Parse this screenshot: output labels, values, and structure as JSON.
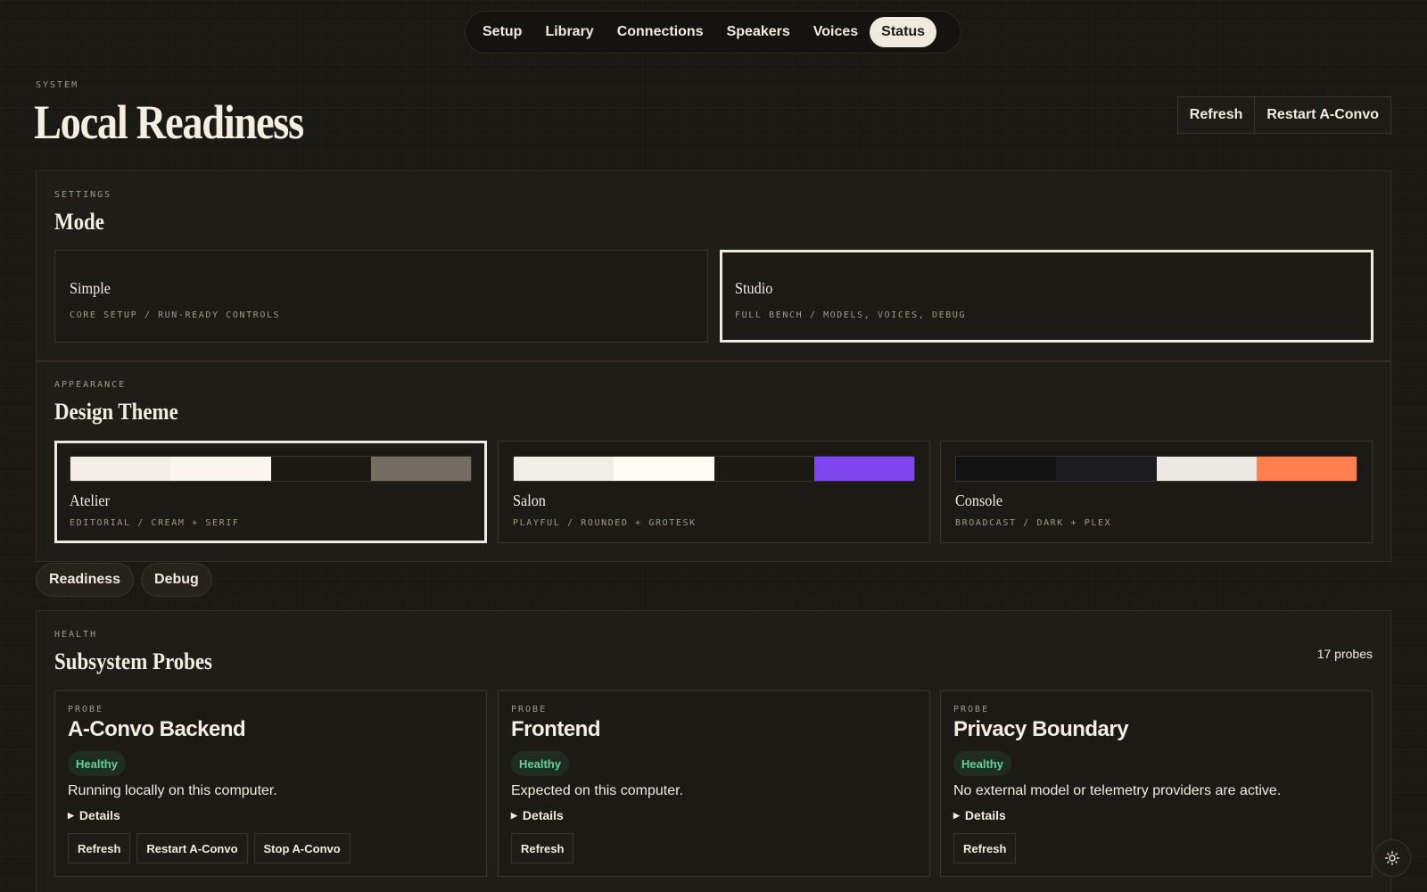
{
  "nav": {
    "items": [
      {
        "label": "Setup",
        "active": false
      },
      {
        "label": "Library",
        "active": false
      },
      {
        "label": "Connections",
        "active": false
      },
      {
        "label": "Speakers",
        "active": false
      },
      {
        "label": "Voices",
        "active": false
      },
      {
        "label": "Status",
        "active": true
      }
    ]
  },
  "header": {
    "eyebrow": "SYSTEM",
    "title": "Local Readiness",
    "refresh_label": "Refresh",
    "restart_label": "Restart A-Convo"
  },
  "mode": {
    "eyebrow": "SETTINGS",
    "title": "Mode",
    "options": [
      {
        "title": "Simple",
        "subtitle": "CORE SETUP / RUN-READY CONTROLS",
        "selected": false
      },
      {
        "title": "Studio",
        "subtitle": "FULL BENCH / MODELS, VOICES, DEBUG",
        "selected": true
      }
    ]
  },
  "theme": {
    "eyebrow": "APPEARANCE",
    "title": "Design Theme",
    "options": [
      {
        "title": "Atelier",
        "subtitle": "EDITORIAL / CREAM + SERIF",
        "selected": true,
        "swatches": [
          "#f4ede6",
          "#faf6ee",
          "#1b1914",
          "#756c62"
        ]
      },
      {
        "title": "Salon",
        "subtitle": "PLAYFUL / ROUNDED + GROTESK",
        "selected": false,
        "swatches": [
          "#efefe6",
          "#fcfcf2",
          "#1b1914",
          "#7f45ee"
        ]
      },
      {
        "title": "Console",
        "subtitle": "BROADCAST / DARK + PLEX",
        "selected": false,
        "swatches": [
          "#121212",
          "#1c1b1f",
          "#ebe9e4",
          "#ff7f4f"
        ]
      }
    ]
  },
  "subtabs": [
    {
      "label": "Readiness"
    },
    {
      "label": "Debug"
    }
  ],
  "probes": {
    "eyebrow": "HEALTH",
    "title": "Subsystem Probes",
    "count_label": "17 probes",
    "cards": [
      {
        "eyebrow": "PROBE",
        "title": "A-Convo Backend",
        "status": "Healthy",
        "description": "Running locally on this computer.",
        "details_label": "Details",
        "actions": [
          "Refresh",
          "Restart A-Convo",
          "Stop A-Convo"
        ]
      },
      {
        "eyebrow": "PROBE",
        "title": "Frontend",
        "status": "Healthy",
        "description": "Expected on this computer.",
        "details_label": "Details",
        "actions": [
          "Refresh"
        ]
      },
      {
        "eyebrow": "PROBE",
        "title": "Privacy Boundary",
        "status": "Healthy",
        "description": "No external model or telemetry providers are active.",
        "details_label": "Details",
        "actions": [
          "Refresh"
        ]
      }
    ]
  },
  "icons": {
    "theme_toggle": "sun-icon"
  },
  "colors": {
    "background": "#1b1914",
    "panel": "#1f1d18",
    "accent_cream": "#efe9de",
    "healthy": "#5fd39a"
  }
}
